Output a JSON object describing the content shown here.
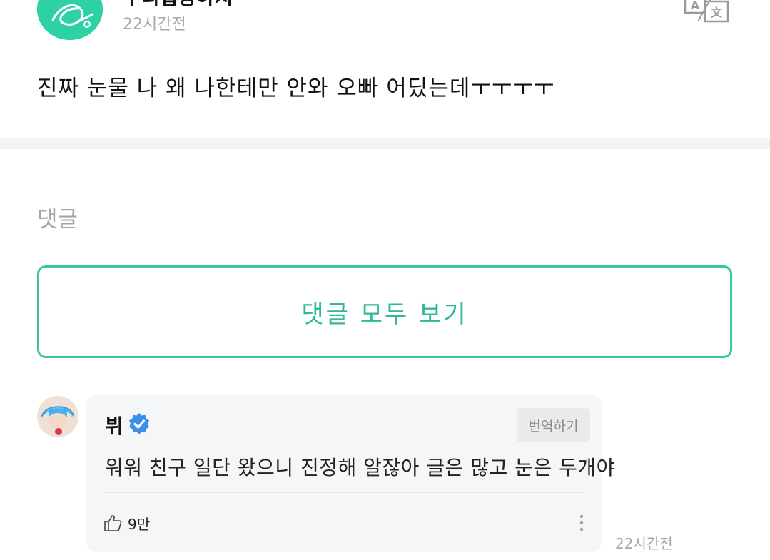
{
  "post": {
    "author": "우리집강아지",
    "time": "22시간전",
    "body": "진짜 눈물 나 왜 나한테만 안와 오빠 어딨는데ㅜㅜㅜㅜ"
  },
  "comments_section": {
    "heading": "댓글",
    "view_all_label": "댓글 모두 보기"
  },
  "comment": {
    "author": "뷔",
    "verified": true,
    "translate_label": "번역하기",
    "text": "워워 친구 일단 왔으니 진정해 알잖아 글은 많고 눈은 두개야",
    "likes": "9만",
    "time": "22시간전"
  },
  "icons": {
    "translate": "translate-icon",
    "verified": "verified-badge-icon",
    "like": "thumbs-up-icon",
    "more": "more-vertical-icon"
  },
  "colors": {
    "accent": "#3cc4a7",
    "verified": "#3b8fe8",
    "muted_text": "#a7a7a7",
    "bubble_bg": "#f5f6f8"
  }
}
